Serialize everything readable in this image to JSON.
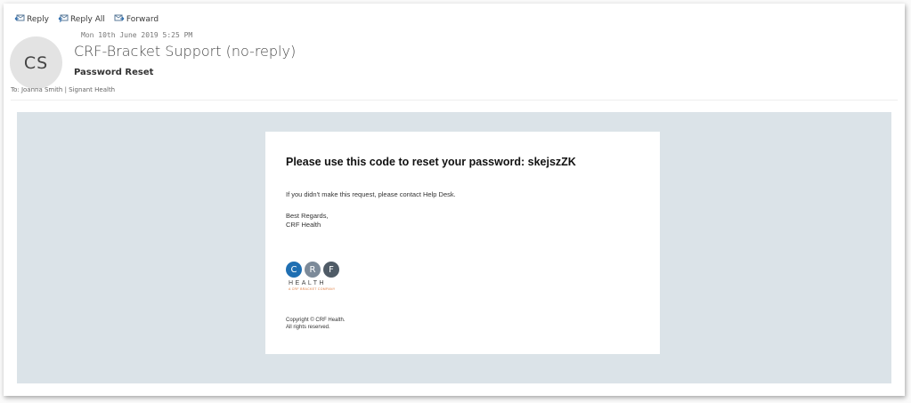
{
  "toolbar": {
    "reply_label": "Reply",
    "reply_all_label": "Reply All",
    "forward_label": "Forward"
  },
  "message": {
    "sender_initials": "CS",
    "date": "Mon 10th June 2019 5:25 PM",
    "sender": "CRF-Bracket Support (no-reply)",
    "subject": "Password Reset",
    "to_line": "To: Joanna Smith | Signant Health"
  },
  "email_body": {
    "heading": "Please use this code to reset your password: skejszZK",
    "help_text": "If you didn't make this request, please contact Help Desk.",
    "regards": "Best Regards,",
    "signature": "CRF Health",
    "logo": {
      "letter_c": "C",
      "letter_r": "R",
      "letter_f": "F",
      "word": "HEALTH",
      "tagline": "A CRF BRACKET COMPANY"
    },
    "copyright": "Copyright © CRF Health.",
    "rights": "All rights reserved."
  },
  "colors": {
    "body_background": "#dbe3e8",
    "logo_c": "#1f6fb2",
    "logo_r": "#7c8a99",
    "logo_f": "#4f5b66",
    "logo_tagline": "#e07a3b"
  },
  "icons": [
    "reply-icon",
    "reply-all-icon",
    "forward-icon"
  ]
}
